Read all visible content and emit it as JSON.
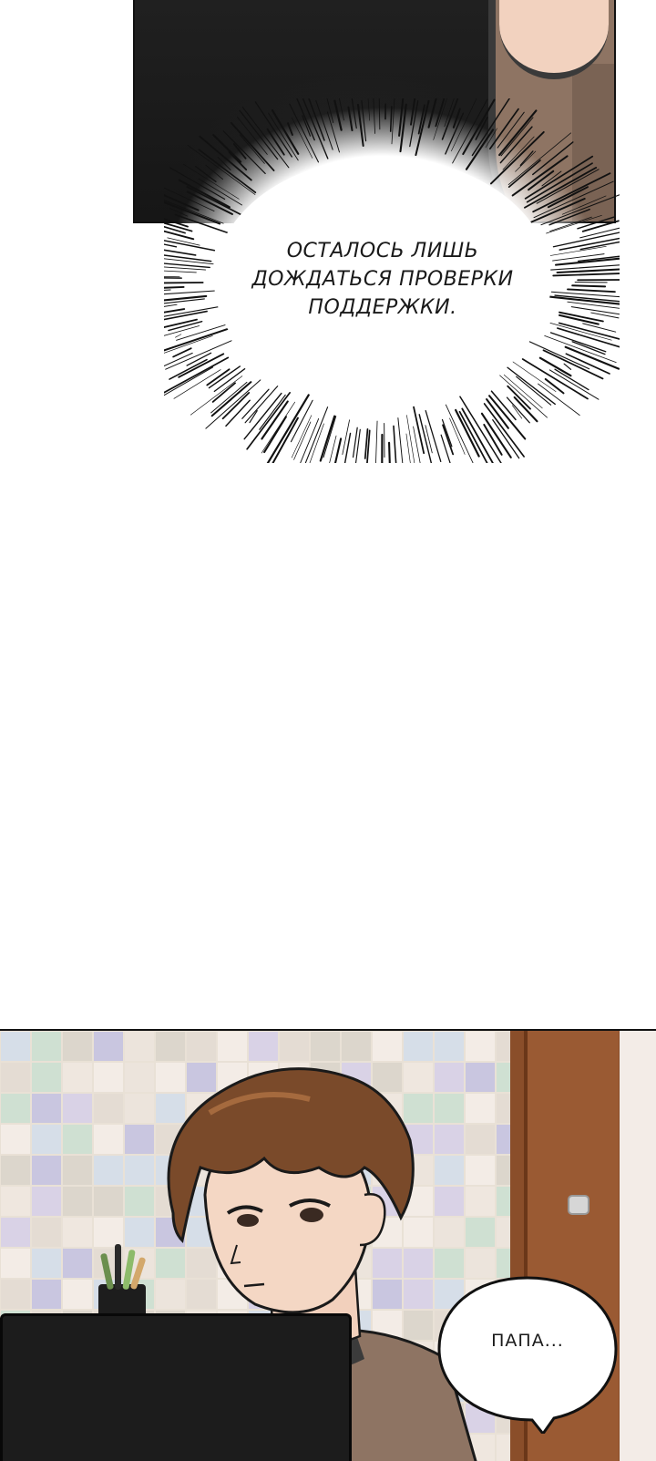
{
  "panels": {
    "burst_caption": {
      "lines": [
        "ОСТАЛОСЬ ЛИШЬ",
        "ДОЖДАТЬСЯ ПРОВЕРКИ",
        "ПОДДЕРЖКИ."
      ]
    },
    "speech_bubble": {
      "text": "ПАПА..."
    }
  },
  "colors": {
    "panel_border": "#111111",
    "hair": "#7a4a2a",
    "skin": "#f4d7c4",
    "door": "#9a5a33",
    "shirt": "#8e7463"
  }
}
